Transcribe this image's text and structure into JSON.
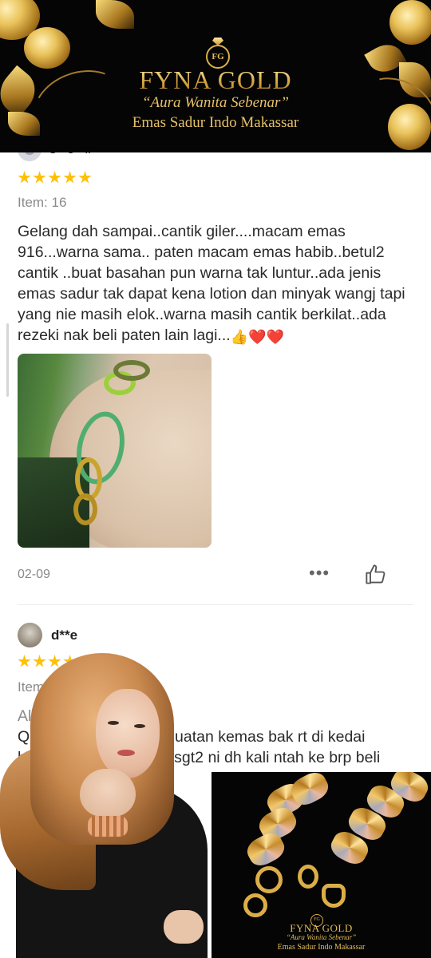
{
  "brand": {
    "name": "FYNA GOLD",
    "logo_mark": "FG",
    "tagline": "“Aura Wanita Sebenar”",
    "subtitle": "Emas Sadur Indo Makassar"
  },
  "review_1": {
    "username": "s**e**ll",
    "rating": 5,
    "item_label": "Item: 16",
    "text": "Gelang dah sampai..cantik giler....macam emas 916...warna sama.. paten macam emas habib..betul2 cantik ..buat basahan pun warna tak luntur..ada jenis emas sadur tak dapat kena lotion dan minyak wangj tapi yang nie masih elok..warna masih cantik berkilat..ada rezeki nak beli paten lain lagi...",
    "emojis": [
      "👍",
      "❤️",
      "❤️"
    ],
    "date": "02-09",
    "more_label": "•••"
  },
  "review_2": {
    "username": "d**e",
    "rating": 5,
    "item_label": "Item: Q",
    "text_line1": "Aller",
    "text_line2_start": "Qu",
    "text_line2_end": "uatan kemas bak rt di kedai",
    "text_line3_start": "ha",
    "text_line3_end": "ti sgt2 ni dh kali ntah ke brp beli"
  },
  "icons": {
    "like": "thumbs-up-icon",
    "more": "more-dots-icon",
    "star": "star-icon"
  },
  "colors": {
    "star": "#ffc107",
    "gold": "#e3bd55",
    "banner_bg": "#050505",
    "muted_text": "#8a8a8a"
  }
}
